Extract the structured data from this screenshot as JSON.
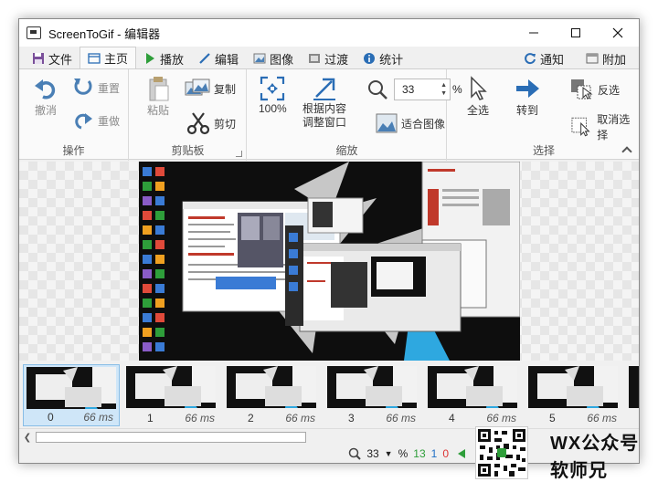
{
  "window": {
    "title": "ScreenToGif - 编辑器"
  },
  "tabs": [
    {
      "label": "文件",
      "icon": "save-icon"
    },
    {
      "label": "主页",
      "icon": "home-icon",
      "active": true
    },
    {
      "label": "播放",
      "icon": "play-icon"
    },
    {
      "label": "编辑",
      "icon": "pencil-icon"
    },
    {
      "label": "图像",
      "icon": "image-icon"
    },
    {
      "label": "过渡",
      "icon": "transition-icon"
    },
    {
      "label": "统计",
      "icon": "info-icon"
    }
  ],
  "tabs_right": {
    "notify": "通知",
    "extra": "附加"
  },
  "ribbon": {
    "operations": {
      "label": "操作",
      "undo": "撤消",
      "redo": "重置",
      "reset": "重做"
    },
    "clipboard": {
      "label": "剪贴板",
      "paste": "粘贴",
      "copy": "复制",
      "cut": "剪切"
    },
    "zoom": {
      "label": "缩放",
      "hundred": "100%",
      "fit_window_line1": "根据内容",
      "fit_window_line2": "调整窗口",
      "zoom_value": "33",
      "percent": "%",
      "fit_image": "适合图像"
    },
    "select": {
      "label": "选择",
      "select_all": "全选",
      "goto": "转到",
      "invert": "反选",
      "deselect": "取消选择"
    }
  },
  "frames": [
    {
      "index": "0",
      "delay": "66 ms",
      "selected": true
    },
    {
      "index": "1",
      "delay": "66 ms"
    },
    {
      "index": "2",
      "delay": "66 ms"
    },
    {
      "index": "3",
      "delay": "66 ms"
    },
    {
      "index": "4",
      "delay": "66 ms"
    },
    {
      "index": "5",
      "delay": "66 ms"
    }
  ],
  "status": {
    "zoom": "33",
    "percent": "%",
    "frame_count": "13",
    "selected_count": "1",
    "current_frame": "0"
  },
  "watermark": {
    "line1": "WX公众号",
    "line2": "软师兄"
  },
  "colors": {
    "accent_blue": "#1f6fc5",
    "green": "#2e9e3a",
    "red": "#d33",
    "selected_frame": "#cfe6f8"
  }
}
